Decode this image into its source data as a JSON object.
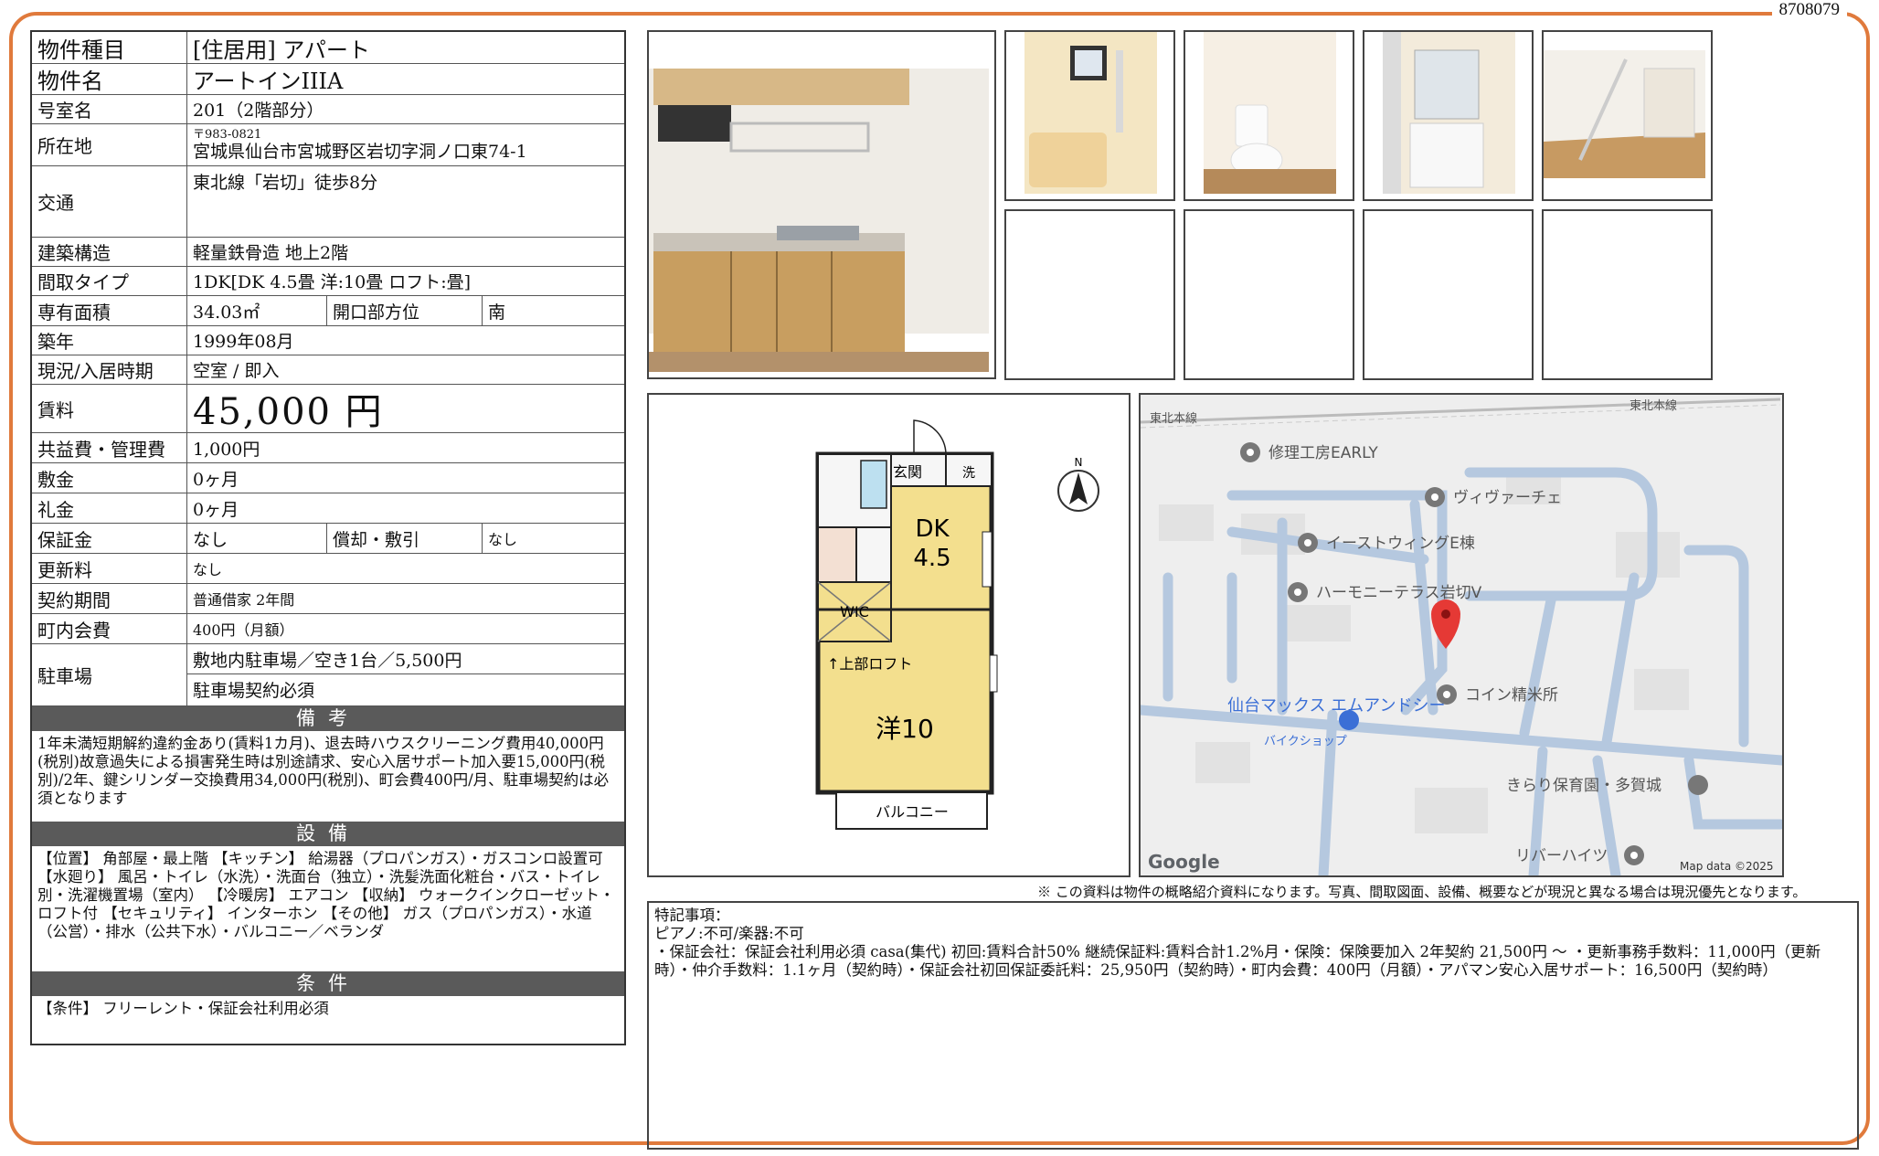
{
  "doc_number": "8708079",
  "property": {
    "type_label": "物件種目",
    "type_value": "[住居用] アパート",
    "name_label": "物件名",
    "name_value": "アートインIIIA",
    "room_label": "号室名",
    "room_value": "201（2階部分）",
    "address_label": "所在地",
    "postal": "〒983-0821",
    "address_value": "宮城県仙台市宮城野区岩切字洞ノ口東74-1",
    "transport_label": "交通",
    "transport_value": "東北線「岩切」徒歩8分",
    "structure_label": "建築構造",
    "structure_value": "軽量鉄骨造 地上2階",
    "layout_label": "間取タイプ",
    "layout_value": "1DK[DK 4.5畳 洋:10畳 ロフト:畳]",
    "area_label": "専有面積",
    "area_value": "34.03㎡",
    "direction_label": "開口部方位",
    "direction_value": "南",
    "built_label": "築年",
    "built_value": "1999年08月",
    "status_label": "現況/入居時期",
    "status_value": "空室 / 即入",
    "rent_label": "賃料",
    "rent_value": "45,000 円",
    "fee_label": "共益費・管理費",
    "fee_value": "1,000円",
    "deposit_label": "敷金",
    "deposit_value": "0ヶ月",
    "keymoney_label": "礼金",
    "keymoney_value": "0ヶ月",
    "guarantee_label": "保証金",
    "guarantee_value": "なし",
    "amort_label": "償却・敷引",
    "amort_value": "なし",
    "renewal_label": "更新料",
    "renewal_value": "なし",
    "contract_label": "契約期間",
    "contract_value": "普通借家 2年間",
    "townfee_label": "町内会費",
    "townfee_value": "400円（月額）",
    "parking_label": "駐車場",
    "parking_value1": "敷地内駐車場／空き1台／5,500円",
    "parking_value2": "駐車場契約必須"
  },
  "remarks": {
    "title": "備考",
    "text": "1年未満短期解約違約金あり(賃料1カ月)、退去時ハウスクリーニング費用40,000円(税別)故意過失による損害発生時は別途請求、安心入居サポート加入要15,000円(税別)/2年、鍵シリンダー交換費用34,000円(税別)、町会費400円/月、駐車場契約は必須となります"
  },
  "equipment": {
    "title": "設備",
    "text": "【位置】 角部屋・最上階 【キッチン】 給湯器（プロパンガス）・ガスコンロ設置可 【水廻り】 風呂・トイレ（水洗）・洗面台（独立）・洗髪洗面化粧台・バス・トイレ別・洗濯機置場（室内） 【冷暖房】 エアコン 【収納】 ウォークインクローゼット・ロフト付 【セキュリティ】 インターホン 【その他】 ガス（プロパンガス）・水道（公営）・排水（公共下水）・バルコニー／ベランダ"
  },
  "conditions": {
    "title": "条件",
    "text": "【条件】 フリーレント・保証会社利用必須"
  },
  "floorplan": {
    "entrance": "玄関",
    "wash": "洗",
    "dk": "DK",
    "dk_size": "4.5",
    "wic": "WIC",
    "loft": "↑上部ロフト",
    "western": "洋10",
    "balcony": "バルコニー",
    "north": "N"
  },
  "map": {
    "places": [
      "修理工房EARLY",
      "ヴィヴァーチェ",
      "イーストウィングE棟",
      "ハーモニーテラス岩切V",
      "コイン精米所",
      "仙台マックス エムアンドシー",
      "バイクショップ",
      "きらり保育園・多賀城",
      "リバーハイツ"
    ],
    "rail_left": "東北本線",
    "rail_right": "東北本線",
    "logo": "Google",
    "credit": "Map data ©2025"
  },
  "caution": "※ この資料は物件の概略紹介資料になります。写真、間取図面、設備、概要などが現況と異なる場合は現況優先となります。",
  "notes": {
    "title": "特記事項：",
    "line1": "ピアノ:不可/楽器:不可",
    "line2": "・保証会社：保証会社利用必須 casa(集代) 初回:賃料合計50% 継続保証料:賃料合計1.2%月・保険：保険要加入 2年契約 21,500円 〜 ・更新事務手数料：11,000円（更新時）・仲介手数料：1.1ヶ月（契約時）・保証会社初回保証委託料：25,950円（契約時）・町内会費：400円（月額）・アパマン安心入居サポート：16,500円（契約時）"
  },
  "colors": {
    "frame": "#e07a3c",
    "section": "#5a5a5a",
    "floor": "#f3df8e",
    "pin": "#e53935",
    "map_road": "#b5c8df"
  }
}
